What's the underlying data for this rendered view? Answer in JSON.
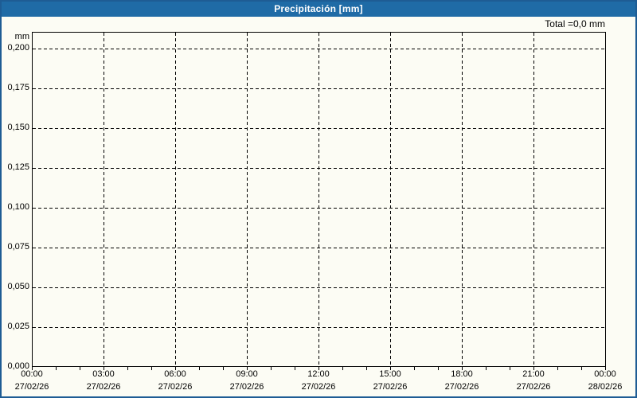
{
  "window": {
    "title": "Precipitación [mm]"
  },
  "summary": {
    "total_label": "Total =0,0 mm"
  },
  "colors": {
    "title_bar_bg": "#1f6ba6",
    "title_text": "#ffffff",
    "frame_border": "#1e5c94",
    "background": "#fcfcf4",
    "plot_border": "#000000",
    "grid_line": "#000000",
    "label_text": "#000000"
  },
  "chart_data": {
    "type": "line",
    "title": "Precipitación [mm]",
    "ylabel": "mm",
    "xlabel": "",
    "total_annotation": "Total =0,0 mm",
    "ylim": [
      0,
      0.21
    ],
    "y_tick_values": [
      0.2,
      0.175,
      0.15,
      0.125,
      0.1,
      0.075,
      0.05,
      0.025,
      0.0
    ],
    "y_tick_labels": [
      "0,200",
      "0,175",
      "0,150",
      "0,125",
      "0,100",
      "0,075",
      "0,050",
      "0,025",
      "0,000"
    ],
    "x_tick_labels": [
      {
        "time": "00:00",
        "date": "27/02/26"
      },
      {
        "time": "03:00",
        "date": "27/02/26"
      },
      {
        "time": "06:00",
        "date": "27/02/26"
      },
      {
        "time": "09:00",
        "date": "27/02/26"
      },
      {
        "time": "12:00",
        "date": "27/02/26"
      },
      {
        "time": "15:00",
        "date": "27/02/26"
      },
      {
        "time": "18:00",
        "date": "27/02/26"
      },
      {
        "time": "21:00",
        "date": "27/02/26"
      },
      {
        "time": "00:00",
        "date": "28/02/26"
      }
    ],
    "x_range_hours": 24,
    "x_major_tick_interval_hours": 3,
    "x_minor_tick_interval_hours": 1,
    "grid": "dashed",
    "legend": "none",
    "series": [
      {
        "name": "Precipitación",
        "unit": "mm",
        "values": [],
        "total": 0.0
      }
    ]
  }
}
